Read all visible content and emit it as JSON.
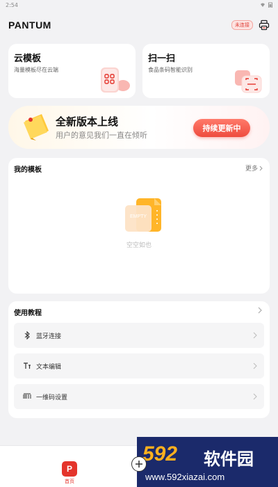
{
  "status": {
    "time": "2:54"
  },
  "header": {
    "logo": "PANTUM",
    "connection_badge": "未连接"
  },
  "cards": {
    "cloud": {
      "title": "云模板",
      "subtitle": "海量模板尽在云端"
    },
    "scan": {
      "title": "扫一扫",
      "subtitle": "食品条码智能识别"
    }
  },
  "banner": {
    "title": "全新版本上线",
    "subtitle": "用户的意见我们一直在倾听",
    "button": "持续更新中"
  },
  "templates": {
    "title": "我的模板",
    "more": "更多",
    "empty_badge": "EMPTY",
    "empty_text": "空空如也"
  },
  "tutorial": {
    "title": "使用教程",
    "items": [
      {
        "label": "蓝牙连接",
        "icon": "bluetooth-icon"
      },
      {
        "label": "文本编辑",
        "icon": "text-icon"
      },
      {
        "label": "一维码设置",
        "icon": "barcode-icon"
      }
    ]
  },
  "bottom": {
    "home_label": "首页",
    "home_glyph": "P"
  },
  "watermark": {
    "main": "592",
    "cn": "软件园",
    "url": "www.592xiazai.com"
  },
  "colors": {
    "accent": "#e4342b",
    "background": "#f2f2f4"
  }
}
